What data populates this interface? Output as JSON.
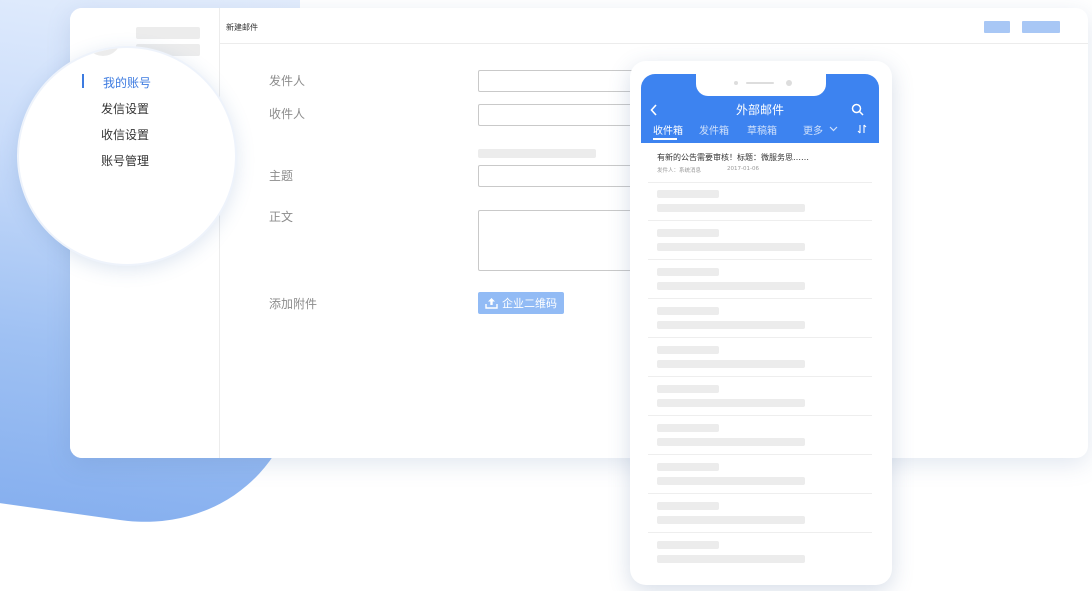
{
  "header": {
    "title": "新建邮件"
  },
  "sidebar_menu": {
    "items": [
      {
        "label": "我的账号",
        "active": true
      },
      {
        "label": "发信设置",
        "active": false
      },
      {
        "label": "收信设置",
        "active": false
      },
      {
        "label": "账号管理",
        "active": false
      }
    ]
  },
  "form": {
    "sender_label": "发件人",
    "recipient_label": "收件人",
    "subject_label": "主题",
    "body_label": "正文",
    "attach_label": "添加附件",
    "upload_button": "企业二维码"
  },
  "phone": {
    "title": "外部邮件",
    "tabs": [
      {
        "label": "收件箱",
        "active": true
      },
      {
        "label": "发件箱",
        "active": false
      },
      {
        "label": "草稿箱",
        "active": false
      },
      {
        "label": "更多",
        "active": false
      }
    ],
    "first_message": {
      "subject": "有新的公告需要审核！标题：微服务思……",
      "sender": "发件人：系统消息",
      "date": "2017-01-06"
    }
  },
  "colors": {
    "accent": "#3d83f0",
    "menu_active": "#3d7be0",
    "upload_button": "#92bbf5"
  }
}
